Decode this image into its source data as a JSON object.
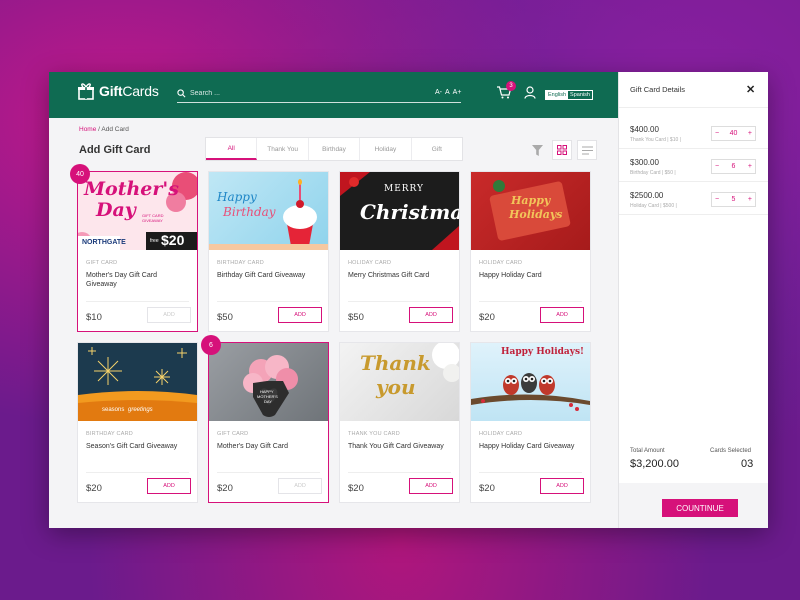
{
  "header": {
    "logo_bold": "Gift",
    "logo_light": "Cards",
    "search_placeholder": "Search ...",
    "font_sizes": [
      "A-",
      "A",
      "A+"
    ],
    "cart_count": "3",
    "languages": [
      "English",
      "Spanish"
    ],
    "active_language": "English"
  },
  "breadcrumb": {
    "home": "Home",
    "sep": "/",
    "current": "Add Card"
  },
  "page_title": "Add Gift Card",
  "tabs": [
    "All",
    "Thank You",
    "Birthday",
    "Holiday",
    "Gift"
  ],
  "active_tab": "All",
  "cards": [
    {
      "category": "GIFT CARD",
      "name": "Mother's Day Gift Card Giveaway",
      "price": "$10",
      "add": "ADD",
      "selected": true,
      "qty": "40",
      "art": {
        "line1": "Mother's",
        "line2": "Day",
        "brand": "NORTHGATE",
        "promo_big": "$20",
        "promo_small": "free",
        "promo_side": "GIFT CARD GIVEAWAY"
      }
    },
    {
      "category": "BIRTHDAY CARD",
      "name": "Birthday Gift Card Giveaway",
      "price": "$50",
      "add": "ADD",
      "selected": false,
      "art": {
        "line1": "Happy",
        "line2": "Birthday"
      }
    },
    {
      "category": "HOLIDAY CARD",
      "name": "Merry Christmas Gift Card",
      "price": "$50",
      "add": "ADD",
      "selected": false,
      "art": {
        "line1": "MERRY",
        "line2": "Christmas"
      }
    },
    {
      "category": "HOLIDAY CARD",
      "name": "Happy Holiday Card",
      "price": "$20",
      "add": "ADD",
      "selected": false,
      "art": {
        "line1": "Happy",
        "line2": "Holidays"
      }
    },
    {
      "category": "BIRTHDAY CARD",
      "name": "Season's Gift Card Giveaway",
      "price": "$20",
      "add": "ADD",
      "selected": false,
      "art": {
        "line1": "seasons",
        "line2": "greetings"
      }
    },
    {
      "category": "GIFT CARD",
      "name": "Mother's Day Gift Card",
      "price": "$20",
      "add": "ADD",
      "selected": true,
      "qty": "6",
      "art": {
        "line1": "HAPPY",
        "line2": "MOTHER'S",
        "line3": "DAY"
      }
    },
    {
      "category": "THANK YOU CARD",
      "name": "Thank You Gift Card Giveaway",
      "price": "$20",
      "add": "ADD",
      "selected": false,
      "art": {
        "line1": "Thank",
        "line2": "you"
      }
    },
    {
      "category": "HOLIDAY CARD",
      "name": "Happy Holiday Card Giveaway",
      "price": "$20",
      "add": "ADD",
      "selected": false,
      "art": {
        "line1": "Happy Holidays!"
      }
    }
  ],
  "panel": {
    "title": "Gift Card Details",
    "items": [
      {
        "amount": "$400.00",
        "sub": "Thank You Card | $10 |",
        "qty": "40"
      },
      {
        "amount": "$300.00",
        "sub": "Birthday Card | $50 |",
        "qty": "6"
      },
      {
        "amount": "$2500.00",
        "sub": "Holiday Card | $500 |",
        "qty": "5"
      }
    ],
    "minus": "−",
    "plus": "+",
    "total_label": "Total Amount",
    "total_value": "$3,200.00",
    "count_label": "Cards Selected",
    "count_value": "03",
    "continue": "COUNTINUE"
  },
  "colors": {
    "brand_green": "#0f6b52",
    "accent_pink": "#d6117a"
  }
}
